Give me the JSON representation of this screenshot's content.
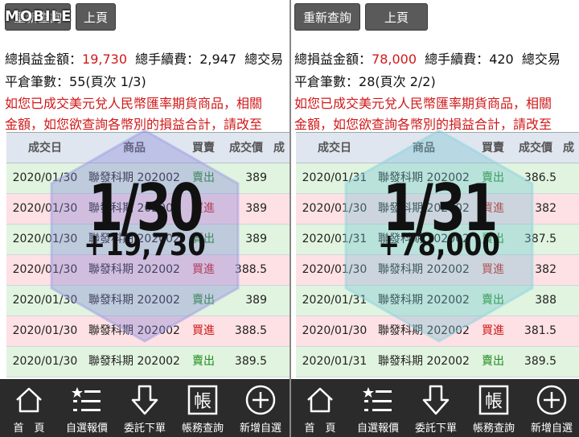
{
  "panels": [
    {
      "logo": "MOBILE",
      "buttons": [
        {
          "label": "重新查詢"
        },
        {
          "label": "上頁"
        }
      ],
      "summary": {
        "total_pl_label": "總損益金額：",
        "total_pl_value": "19,730",
        "fee_label": "總手續費：",
        "fee_value": "2,947",
        "tax_label": "總交易",
        "count_label": "平倉筆數：",
        "count_value": "55(頁次 1/3)"
      },
      "notice_line1": "如您已成交美元兌人民幣匯率期貨商品，相關",
      "notice_line2": "金額，如您欲查詢各幣別的損益合計，請改至",
      "table": {
        "headers": [
          "成交日",
          "商品",
          "買賣",
          "成交價",
          "成"
        ],
        "rows": [
          {
            "date": "2020/01/30",
            "product": "聯發科期 202002",
            "action": "賣出",
            "type": "sell",
            "price": "389"
          },
          {
            "date": "2020/01/30",
            "product": "聯發科期 202002",
            "action": "買進",
            "type": "buy",
            "price": "389"
          },
          {
            "date": "2020/01/30",
            "product": "聯發科期 202002",
            "action": "賣出",
            "type": "sell",
            "price": "389"
          },
          {
            "date": "2020/01/30",
            "product": "聯發科期 202002",
            "action": "買進",
            "type": "buy",
            "price": "388.5"
          },
          {
            "date": "2020/01/30",
            "product": "聯發科期 202002",
            "action": "賣出",
            "type": "sell",
            "price": "389"
          },
          {
            "date": "2020/01/30",
            "product": "聯發科期 202002",
            "action": "買進",
            "type": "buy",
            "price": "388.5"
          },
          {
            "date": "2020/01/30",
            "product": "聯發科期 202002",
            "action": "賣出",
            "type": "sell",
            "price": "389.5"
          }
        ]
      },
      "overlay": {
        "date": "1/30",
        "amount": "+19,730",
        "color": "#7f7fd6"
      }
    },
    {
      "logo": "",
      "buttons": [
        {
          "label": "重新查詢"
        },
        {
          "label": "上頁"
        }
      ],
      "summary": {
        "total_pl_label": "總損益金額：",
        "total_pl_value": "78,000",
        "fee_label": "總手續費：",
        "fee_value": "420",
        "tax_label": "總交易",
        "count_label": "平倉筆數：",
        "count_value": "28(頁次 2/2)"
      },
      "notice_line1": "如您已成交美元兌人民幣匯率期貨商品，相關",
      "notice_line2": "金額，如您欲查詢各幣別的損益合計，請改至",
      "table": {
        "headers": [
          "成交日",
          "商品",
          "買賣",
          "成交價",
          "成"
        ],
        "rows": [
          {
            "date": "2020/01/31",
            "product": "聯發科期 202002",
            "action": "賣出",
            "type": "sell",
            "price": "386.5"
          },
          {
            "date": "2020/01/30",
            "product": "聯發科期 202002",
            "action": "買進",
            "type": "buy",
            "price": "382"
          },
          {
            "date": "2020/01/31",
            "product": "聯發科期 202002",
            "action": "賣出",
            "type": "sell",
            "price": "387.5"
          },
          {
            "date": "2020/01/30",
            "product": "聯發科期 202002",
            "action": "買進",
            "type": "buy",
            "price": "382"
          },
          {
            "date": "2020/01/31",
            "product": "聯發科期 202002",
            "action": "賣出",
            "type": "sell",
            "price": "388"
          },
          {
            "date": "2020/01/30",
            "product": "聯發科期 202002",
            "action": "買進",
            "type": "buy",
            "price": "381.5"
          },
          {
            "date": "2020/01/31",
            "product": "聯發科期 202002",
            "action": "賣出",
            "type": "sell",
            "price": "389.5"
          }
        ]
      },
      "overlay": {
        "date": "1/31",
        "amount": "+78,000",
        "color": "#6fbfd0"
      }
    }
  ],
  "nav": [
    {
      "label": "首　頁",
      "icon": "home-icon"
    },
    {
      "label": "自選報價",
      "icon": "star-list-icon"
    },
    {
      "label": "委託下單",
      "icon": "order-arrow-icon"
    },
    {
      "label": "帳務查詢",
      "icon": "account-icon",
      "glyph": "帳"
    },
    {
      "label": "新增自選",
      "icon": "add-circle-icon"
    }
  ]
}
